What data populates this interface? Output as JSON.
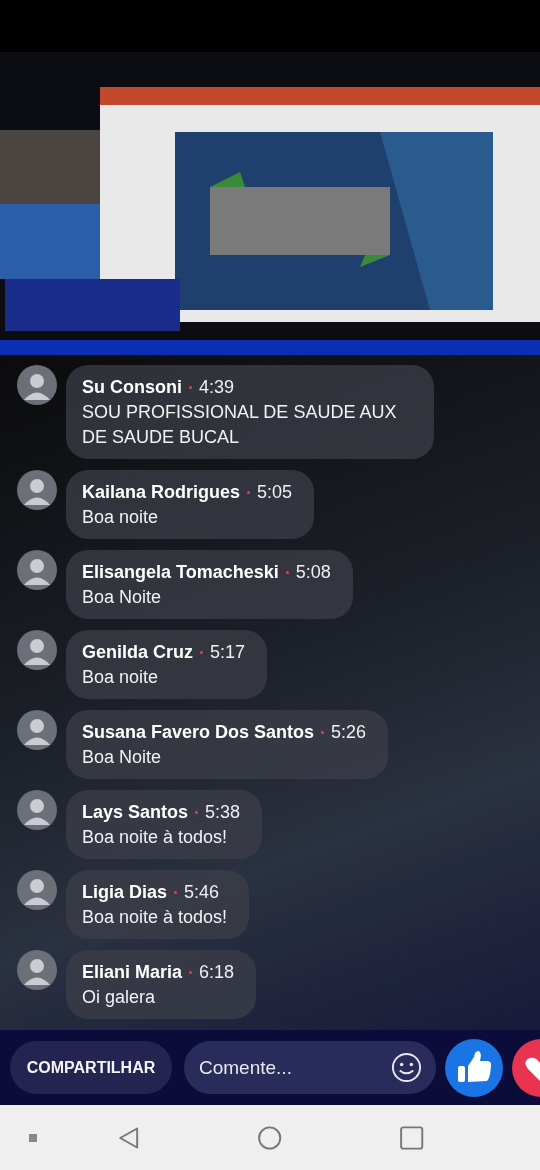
{
  "comments": [
    {
      "name": "Su Consoni",
      "time": "4:39",
      "text": "SOU PROFISSIONAL DE SAUDE AUX DE SAUDE BUCAL"
    },
    {
      "name": "Kailana Rodrigues",
      "time": "5:05",
      "text": "Boa noite"
    },
    {
      "name": "Elisangela Tomacheski",
      "time": "5:08",
      "text": "Boa Noite"
    },
    {
      "name": "Genilda Cruz",
      "time": "5:17",
      "text": "Boa noite"
    },
    {
      "name": "Susana Favero Dos Santos",
      "time": "5:26",
      "text": "Boa Noite"
    },
    {
      "name": "Lays Santos",
      "time": "5:38",
      "text": "Boa noite à todos!"
    },
    {
      "name": "Ligia Dias",
      "time": "5:46",
      "text": "Boa noite à todos!"
    },
    {
      "name": "Eliani Maria",
      "time": "6:18",
      "text": "Oi galera"
    }
  ],
  "share_button": "COMPARTILHAR",
  "comment_field": {
    "placeholder": "Comente..."
  }
}
